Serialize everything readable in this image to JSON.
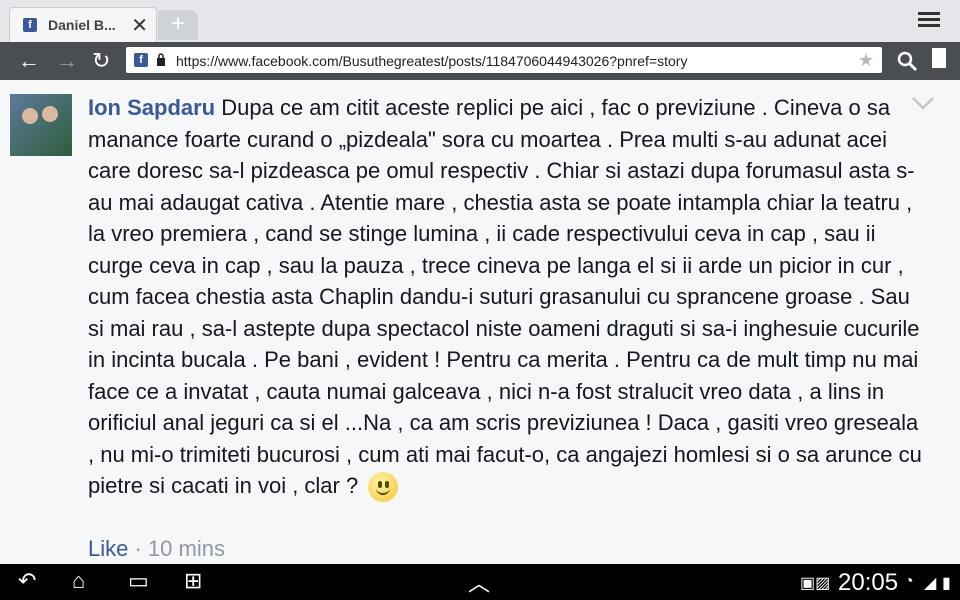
{
  "tab": {
    "title": "Daniel B...",
    "favicon": "f"
  },
  "address": {
    "url": "https://www.facebook.com/Busuthegreatest/posts/1184706044943026?pnref=story"
  },
  "post": {
    "author": "Ion Sapdaru",
    "body": " Dupa ce am citit aceste replici pe aici , fac o previziune . Cineva o sa manance foarte curand o „pizdeala\" sora cu moartea . Prea multi s-au adunat acei care doresc sa-l pizdeasca pe omul respectiv . Chiar si astazi dupa forumasul asta s-au mai adaugat cativa . Atentie mare , chestia asta se poate intampla chiar la teatru , la vreo premiera , cand se stinge lumina , ii cade respectivului ceva in cap , sau ii curge ceva in cap , sau la pauza , trece cineva pe langa el si ii arde un picior in cur , cum facea chestia asta Chaplin dandu-i suturi grasanului cu sprancene groase . Sau si mai rau , sa-l astepte dupa spectacol niste oameni draguti si sa-i inghesuie cucurile in incinta bucala . Pe bani , evident ! Pentru ca merita . Pentru ca de mult timp nu mai face ce a invatat , cauta numai galceava , nici n-a fost stralucit vreo data , a lins in orificiul anal jeguri ca si el ...Na , ca am scris previziunea ! Daca , gasiti vreo greseala , nu mi-o trimiteti bucurosi , cum ati mai facut-o, ca angajezi homlesi si o sa arunce cu pietre si cacati in voi , clar ? ",
    "like_label": "Like",
    "separator": " · ",
    "time": "10 mins"
  },
  "status": {
    "time": "20:05"
  },
  "colors": {
    "link": "#3b5998",
    "muted": "#9197a3"
  }
}
